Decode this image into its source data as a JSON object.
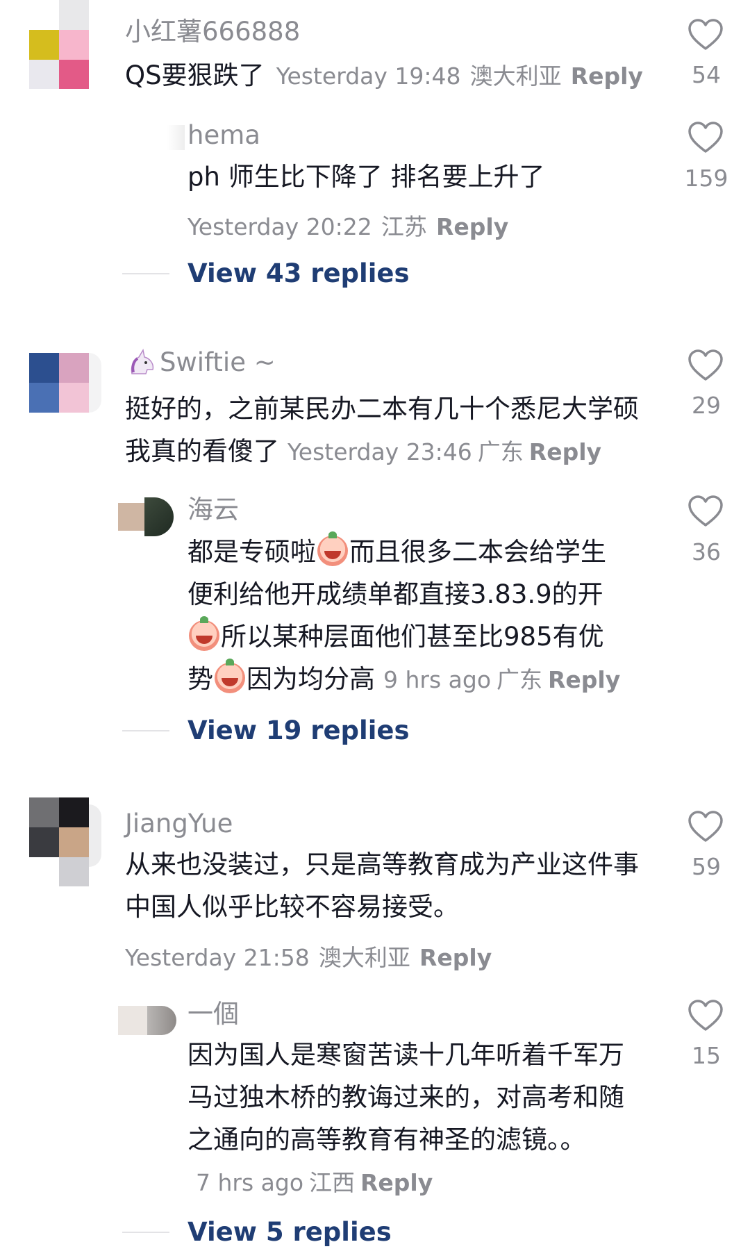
{
  "comments": [
    {
      "username": "小红薯666888",
      "text": "QS要狠跌了",
      "time": "Yesterday 19:48",
      "location": "澳大利亚",
      "reply_label": "Reply",
      "likes": "54",
      "replies": [
        {
          "username": "hema",
          "text": "ph 师生比下降了 排名要上升了",
          "time": "Yesterday 20:22",
          "location": "江苏",
          "reply_label": "Reply",
          "likes": "159"
        }
      ],
      "view_replies": "View 43 replies"
    },
    {
      "username": "Swiftie ~",
      "text": "挺好的，之前某民办二本有几十个悉尼大学硕我真的看傻了",
      "time": "Yesterday 23:46",
      "location": "广东",
      "reply_label": "Reply",
      "likes": "29",
      "replies": [
        {
          "username": "海云",
          "text_line1_a": "都是专硕啦",
          "text_line1_b": "而且很多二本会给学生",
          "text_line2": "便利给他开成绩单都直接3.83.9的开",
          "text_line3": "所以某种层面他们甚至比985有优",
          "text_line4_a": "势",
          "text_line4_b": "因为均分高",
          "time": "9 hrs ago",
          "location": "广东",
          "reply_label": "Reply",
          "likes": "36"
        }
      ],
      "view_replies": "View 19 replies"
    },
    {
      "username": "JiangYue",
      "text": "从来也没装过，只是高等教育成为产业这件事中国人似乎比较不容易接受。",
      "time": "Yesterday 21:58",
      "location": "澳大利亚",
      "reply_label": "Reply",
      "likes": "59",
      "replies": [
        {
          "username": "一個",
          "text": "因为国人是寒窗苦读十几年听着千军万马过独木桥的教诲过来的，对高考和随之通向的高等教育有神圣的滤镜。。",
          "time": "7 hrs ago",
          "location": "江西",
          "reply_label": "Reply",
          "likes": "15"
        }
      ],
      "view_replies": "View 5 replies"
    }
  ],
  "icons": {
    "like": "heart-outline-icon",
    "emoji_crying": "crying-face-emoji-icon",
    "emoji_unicorn": "unicorn-emoji-icon"
  },
  "colors": {
    "text": "#161823",
    "secondary": "#8a8b91",
    "link": "#1f3d74"
  }
}
